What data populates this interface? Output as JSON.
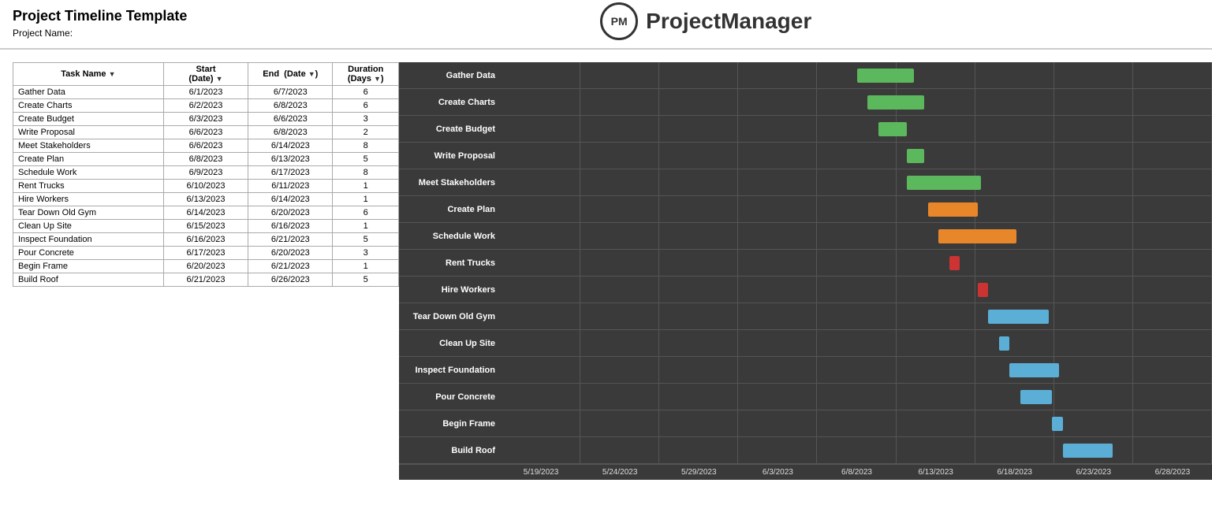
{
  "header": {
    "title": "Project Timeline Template",
    "project_label": "Project Name:",
    "logo_initials": "PM",
    "logo_brand": "ProjectManager"
  },
  "table": {
    "columns": [
      {
        "label": "Task Name",
        "sub": "",
        "key": "name"
      },
      {
        "label": "Start",
        "sub": "(Date)",
        "key": "start"
      },
      {
        "label": "End",
        "sub": "(Date)",
        "key": "end"
      },
      {
        "label": "Duration",
        "sub": "(Days)",
        "key": "duration"
      }
    ],
    "rows": [
      {
        "name": "Gather Data",
        "start": "6/1/2023",
        "end": "6/7/2023",
        "duration": "6"
      },
      {
        "name": "Create Charts",
        "start": "6/2/2023",
        "end": "6/8/2023",
        "duration": "6"
      },
      {
        "name": "Create Budget",
        "start": "6/3/2023",
        "end": "6/6/2023",
        "duration": "3"
      },
      {
        "name": "Write Proposal",
        "start": "6/6/2023",
        "end": "6/8/2023",
        "duration": "2"
      },
      {
        "name": "Meet Stakeholders",
        "start": "6/6/2023",
        "end": "6/14/2023",
        "duration": "8"
      },
      {
        "name": "Create Plan",
        "start": "6/8/2023",
        "end": "6/13/2023",
        "duration": "5"
      },
      {
        "name": "Schedule Work",
        "start": "6/9/2023",
        "end": "6/17/2023",
        "duration": "8"
      },
      {
        "name": "Rent Trucks",
        "start": "6/10/2023",
        "end": "6/11/2023",
        "duration": "1"
      },
      {
        "name": "Hire Workers",
        "start": "6/13/2023",
        "end": "6/14/2023",
        "duration": "1"
      },
      {
        "name": "Tear Down Old Gym",
        "start": "6/14/2023",
        "end": "6/20/2023",
        "duration": "6"
      },
      {
        "name": "Clean Up Site",
        "start": "6/15/2023",
        "end": "6/16/2023",
        "duration": "1"
      },
      {
        "name": "Inspect Foundation",
        "start": "6/16/2023",
        "end": "6/21/2023",
        "duration": "5"
      },
      {
        "name": "Pour Concrete",
        "start": "6/17/2023",
        "end": "6/20/2023",
        "duration": "3"
      },
      {
        "name": "Begin Frame",
        "start": "6/20/2023",
        "end": "6/21/2023",
        "duration": "1"
      },
      {
        "name": "Build Roof",
        "start": "6/21/2023",
        "end": "6/26/2023",
        "duration": "5"
      }
    ]
  },
  "gantt": {
    "axis_labels": [
      "5/19/2023",
      "5/24/2023",
      "5/29/2023",
      "6/3/2023",
      "6/8/2023",
      "6/13/2023",
      "6/18/2023",
      "6/23/2023",
      "6/28/2023"
    ],
    "rows": [
      {
        "label": "Gather Data",
        "left_pct": 50.0,
        "width_pct": 8.0,
        "color": "bar-green"
      },
      {
        "label": "Create Charts",
        "left_pct": 51.5,
        "width_pct": 8.0,
        "color": "bar-green"
      },
      {
        "label": "Create Budget",
        "left_pct": 53.0,
        "width_pct": 4.0,
        "color": "bar-green"
      },
      {
        "label": "Write Proposal",
        "left_pct": 57.0,
        "width_pct": 2.5,
        "color": "bar-green"
      },
      {
        "label": "Meet Stakeholders",
        "left_pct": 57.0,
        "width_pct": 10.5,
        "color": "bar-green"
      },
      {
        "label": "Create Plan",
        "left_pct": 60.0,
        "width_pct": 7.0,
        "color": "bar-orange"
      },
      {
        "label": "Schedule Work",
        "left_pct": 61.5,
        "width_pct": 11.0,
        "color": "bar-orange"
      },
      {
        "label": "Rent Trucks",
        "left_pct": 63.0,
        "width_pct": 1.5,
        "color": "bar-red"
      },
      {
        "label": "Hire Workers",
        "left_pct": 67.0,
        "width_pct": 1.5,
        "color": "bar-red"
      },
      {
        "label": "Tear Down Old Gym",
        "left_pct": 68.5,
        "width_pct": 8.5,
        "color": "bar-blue"
      },
      {
        "label": "Clean Up Site",
        "left_pct": 70.0,
        "width_pct": 1.5,
        "color": "bar-blue"
      },
      {
        "label": "Inspect Foundation",
        "left_pct": 71.5,
        "width_pct": 7.0,
        "color": "bar-blue"
      },
      {
        "label": "Pour Concrete",
        "left_pct": 73.0,
        "width_pct": 4.5,
        "color": "bar-blue"
      },
      {
        "label": "Begin Frame",
        "left_pct": 77.5,
        "width_pct": 1.5,
        "color": "bar-blue"
      },
      {
        "label": "Build Roof",
        "left_pct": 79.0,
        "width_pct": 7.0,
        "color": "bar-blue"
      }
    ]
  }
}
